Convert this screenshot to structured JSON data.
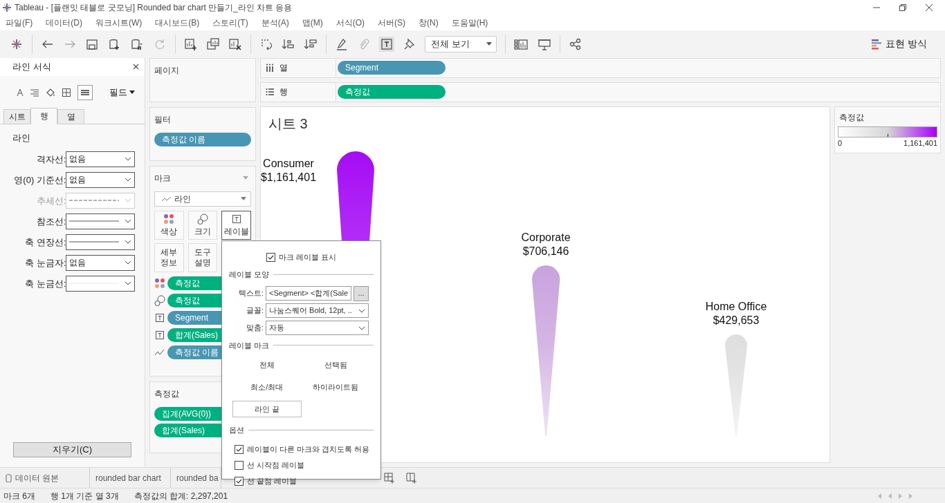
{
  "window": {
    "title": "Tableau - [플랜잇 태블로 굿모닝] Rounded bar chart 만들기_라인 차트 응용"
  },
  "menu": [
    "파일(F)",
    "데이터(D)",
    "워크시트(W)",
    "대시보드(B)",
    "스토리(T)",
    "분석(A)",
    "맵(M)",
    "서식(O)",
    "서버(S)",
    "창(N)",
    "도움말(H)"
  ],
  "toolbar": {
    "view_dropdown": "전체 보기",
    "show_me": "표현 방식"
  },
  "format_pane": {
    "title": "라인 서식",
    "field_menu": "필드",
    "tabs": [
      {
        "label": "시트",
        "selected": false
      },
      {
        "label": "행",
        "selected": true
      },
      {
        "label": "열",
        "selected": false
      }
    ],
    "section": "라인",
    "rows": [
      {
        "label": "격자선:",
        "kind": "text",
        "value": "없음",
        "disabled": false
      },
      {
        "label": "영(0) 기준선:",
        "kind": "text",
        "value": "없음",
        "disabled": false
      },
      {
        "label": "추세선:",
        "kind": "dashed",
        "disabled": true
      },
      {
        "label": "참조선:",
        "kind": "thick",
        "disabled": false
      },
      {
        "label": "축 연장선:",
        "kind": "thin",
        "disabled": false
      },
      {
        "label": "축 눈금자:",
        "kind": "text",
        "value": "없음",
        "disabled": false
      },
      {
        "label": "축 눈금선:",
        "kind": "faint",
        "disabled": false
      }
    ],
    "clear_button": "지우기(C)"
  },
  "pages_card": {
    "title": "페이지"
  },
  "filters_card": {
    "title": "필터",
    "pills": [
      {
        "label": "측정값 이름",
        "color": "#4996b2"
      }
    ]
  },
  "marks_card": {
    "title": "마크",
    "mark_type": "라인",
    "buttons": [
      {
        "label": "색상",
        "kind": "color",
        "selected": false
      },
      {
        "label": "크기",
        "kind": "size",
        "selected": false
      },
      {
        "label": "레이블",
        "kind": "label",
        "selected": true
      },
      {
        "label": "세부\n정보",
        "kind": "plain",
        "selected": false
      },
      {
        "label": "도구\n설명",
        "kind": "plain",
        "selected": false
      }
    ],
    "fields": [
      {
        "kind": "color",
        "label": "측정값",
        "color": "#00b180"
      },
      {
        "kind": "size",
        "label": "측정값",
        "color": "#00b180"
      },
      {
        "kind": "label",
        "label": "Segment",
        "color": "#4996b2"
      },
      {
        "kind": "label",
        "label": "합계(Sales)",
        "color": "#00b180"
      },
      {
        "kind": "path",
        "label": "측정값 이름",
        "color": "#4996b2"
      }
    ]
  },
  "measures_card": {
    "title": "측정값",
    "pills": [
      {
        "label": "집계(AVG(0))",
        "color": "#00b180"
      },
      {
        "label": "합계(Sales)",
        "color": "#00b180"
      }
    ]
  },
  "shelves": [
    {
      "kind": "columns",
      "label": "열",
      "pills": [
        {
          "label": "Segment",
          "color": "#4996b2"
        }
      ]
    },
    {
      "kind": "rows",
      "label": "행",
      "pills": [
        {
          "label": "측정값",
          "color": "#00b180"
        }
      ]
    }
  ],
  "view": {
    "title": "시트 3",
    "marks": [
      {
        "name": "Consumer",
        "value": "$1,161,401"
      },
      {
        "name": "Corporate",
        "value": "$706,146"
      },
      {
        "name": "Home Office",
        "value": "$429,653"
      }
    ]
  },
  "legend": {
    "title": "측정값",
    "min": "0",
    "max": "1,161,401"
  },
  "label_popup": {
    "show_labels": {
      "label": "마크 레이블 표시",
      "checked": true
    },
    "appearance_title": "레이블 모양",
    "text_label": "텍스트:",
    "text_value": "<Segment> <합계(Sale",
    "more_button": "...",
    "font_label": "글꼴:",
    "font_value": "나눔스퀘어 Bold, 12pt, ..",
    "align_label": "맞춤:",
    "align_value": "자동",
    "marks_title": "레이블 마크",
    "mark_options": [
      {
        "label": "전체",
        "selected": false
      },
      {
        "label": "선택됨",
        "selected": false
      },
      {
        "label": "최소/최대",
        "selected": false
      },
      {
        "label": "하이라이트됨",
        "selected": false
      },
      {
        "label": "라인 끝",
        "selected": true
      }
    ],
    "options_title": "옵션",
    "options": [
      {
        "label": "레이블이 다른 마크와 겹치도록 허용",
        "checked": true
      },
      {
        "label": "선 시작점 레이블",
        "checked": false
      },
      {
        "label": "선 끝점 레이블",
        "checked": true
      }
    ]
  },
  "sheet_tabs": [
    {
      "kind": "data-source",
      "label": "데이터 원본"
    },
    {
      "kind": "sheet",
      "label": "rounded bar chart"
    },
    {
      "kind": "sheet",
      "label": "rounded ba"
    }
  ],
  "status_bar": [
    "마크 6개",
    "행 1개 기준 열 3개",
    "측정값의 합계: 2,297,201"
  ]
}
